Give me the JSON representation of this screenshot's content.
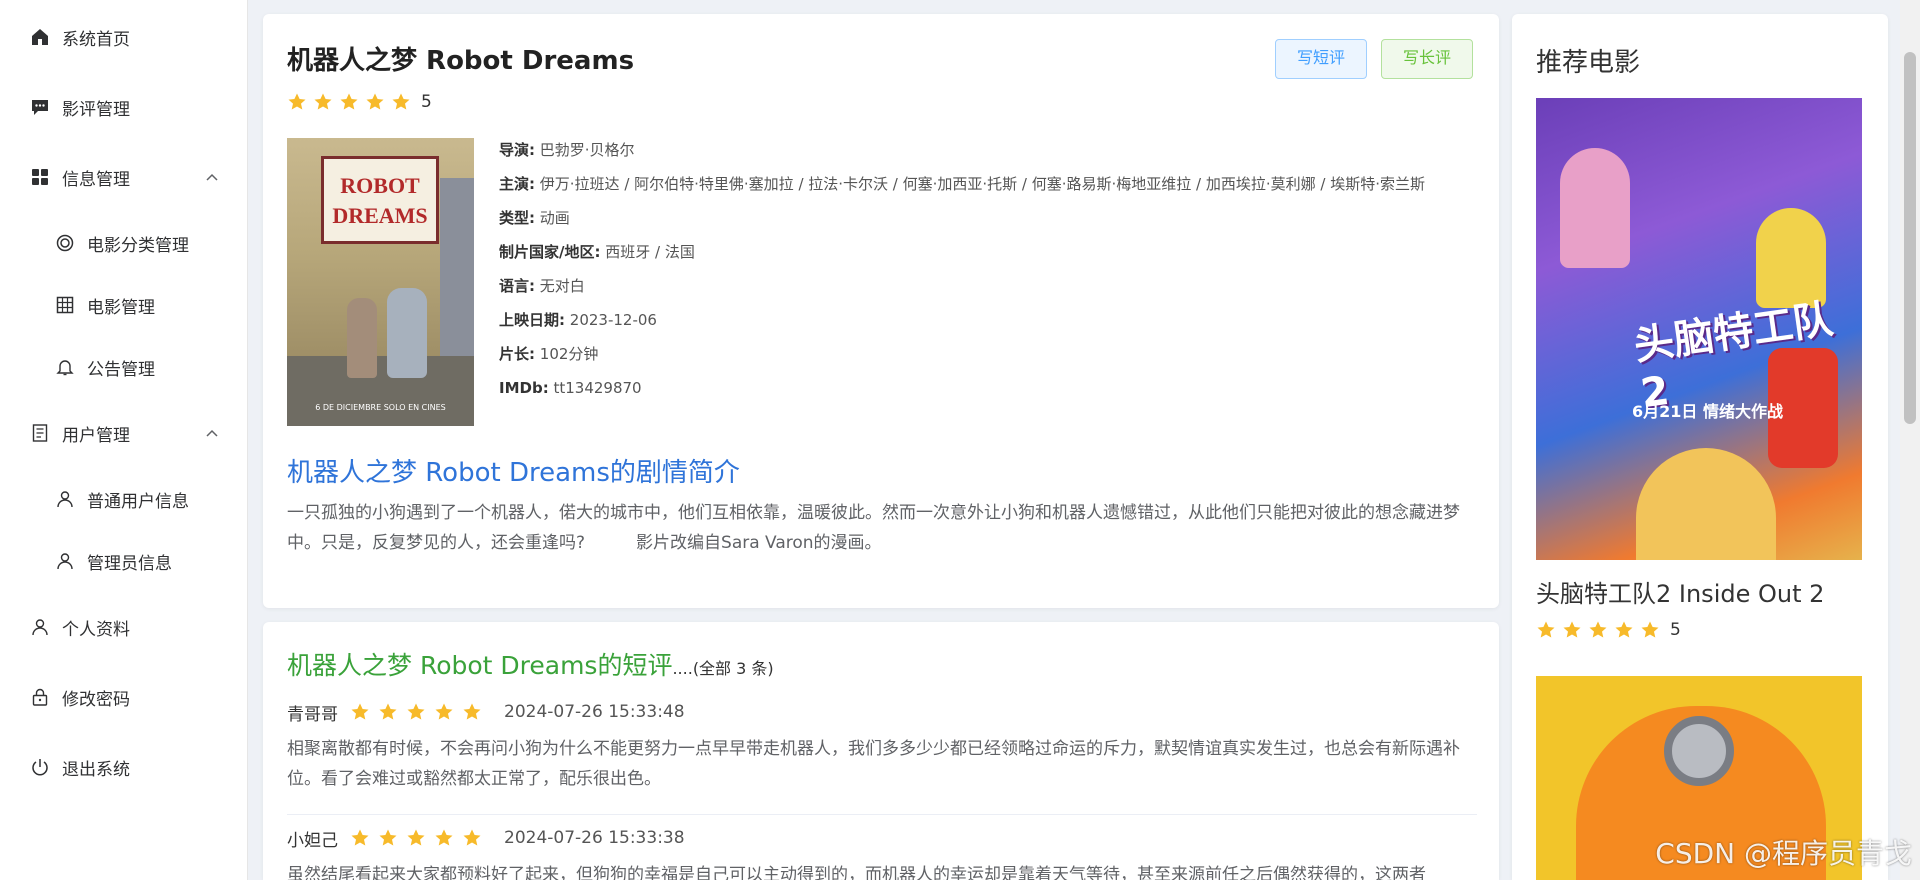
{
  "sidebar": {
    "items": [
      {
        "label": "系统首页",
        "icon": "home-icon"
      },
      {
        "label": "影评管理",
        "icon": "comment-icon"
      },
      {
        "label": "信息管理",
        "icon": "grid-icon",
        "expanded": true
      },
      {
        "label": "电影分类管理",
        "icon": "target-icon",
        "sub": true
      },
      {
        "label": "电影管理",
        "icon": "table-icon",
        "sub": true
      },
      {
        "label": "公告管理",
        "icon": "bell-icon",
        "sub": true
      },
      {
        "label": "用户管理",
        "icon": "document-icon",
        "expanded": true
      },
      {
        "label": "普通用户信息",
        "icon": "user-icon",
        "sub": true
      },
      {
        "label": "管理员信息",
        "icon": "user-icon",
        "sub": true
      },
      {
        "label": "个人资料",
        "icon": "user-icon"
      },
      {
        "label": "修改密码",
        "icon": "lock-icon"
      },
      {
        "label": "退出系统",
        "icon": "power-icon"
      }
    ]
  },
  "movie": {
    "title": "机器人之梦 Robot Dreams",
    "rating": 5,
    "rating_text": "5",
    "poster": {
      "sign": "ROBOT DREAMS",
      "bottom": "6 DE DICIEMBRE SOLO EN CINES"
    },
    "buttons": {
      "short_review": "写短评",
      "long_review": "写长评"
    },
    "info": {
      "director_label": "导演:",
      "director": "巴勃罗·贝格尔",
      "cast_label": "主演:",
      "cast": "伊万·拉班达 / 阿尔伯特·特里佛·塞加拉 / 拉法·卡尔沃 / 何塞·加西亚·托斯 / 何塞·路易斯·梅地亚维拉 / 加西埃拉·莫利娜 / 埃斯特·索兰斯",
      "genre_label": "类型:",
      "genre": "动画",
      "country_label": "制片国家/地区:",
      "country": "西班牙 / 法国",
      "language_label": "语言:",
      "language": "无对白",
      "release_label": "上映日期:",
      "release": "2023-12-06",
      "runtime_label": "片长:",
      "runtime": "102分钟",
      "imdb_label": "IMDb:",
      "imdb": "tt13429870"
    },
    "intro_title": "机器人之梦 Robot Dreams的剧情简介",
    "intro_text": "一只孤独的小狗遇到了一个机器人，偌大的城市中，他们互相依靠，温暖彼此。然而一次意外让小狗和机器人遗憾错过，从此他们只能把对彼此的想念藏进梦中。只是，反复梦见的人，还会重逢吗?　　　影片改编自Sara Varon的漫画。"
  },
  "reviews": {
    "title": "机器人之梦 Robot Dreams的短评",
    "count_text": "....(全部 3 条)",
    "items": [
      {
        "user": "青哥哥",
        "rating": 5,
        "time": "2024-07-26 15:33:48",
        "text": "相聚离散都有时候，不会再问小狗为什么不能更努力一点早早带走机器人，我们多多少少都已经领略过命运的斥力，默契情谊真实发生过，也总会有新际遇补位。看了会难过或豁然都太正常了，配乐很出色。"
      },
      {
        "user": "小妲己",
        "rating": 5,
        "time": "2024-07-26 15:33:38",
        "text": "虽然结尾看起来大家都预料好了起来，但狗狗的幸福是自己可以主动得到的，而机器人的幸运却是靠着天气等待，甚至来源前任之后偶然获得的，这两者"
      }
    ]
  },
  "recommend": {
    "title": "推荐电影",
    "movies": [
      {
        "name": "头脑特工队2 Inside Out 2",
        "rating": 5,
        "rating_text": "5",
        "poster_title": "头脑特工队2",
        "poster_date": "6月21日 情绪大作战"
      }
    ]
  },
  "watermark": "CSDN @程序员青戈",
  "colors": {
    "star": "#f7ba2a",
    "link_blue": "#2f74d9",
    "green": "#3aa23a"
  }
}
